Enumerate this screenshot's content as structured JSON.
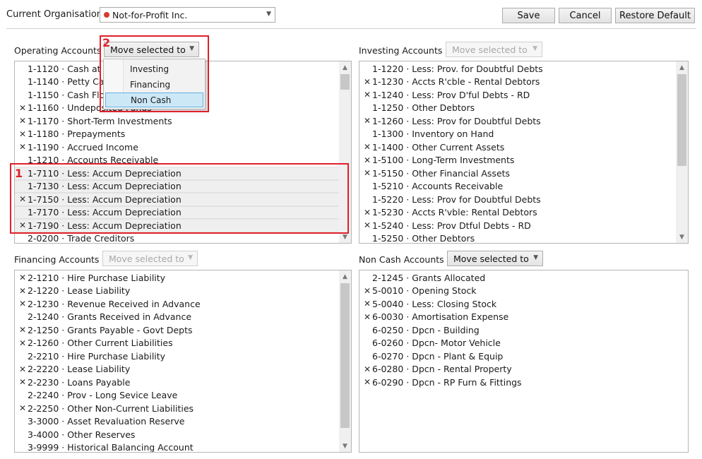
{
  "header": {
    "org_label": "Current Organisation",
    "org_value": "Not-for-Profit Inc.",
    "save": "Save",
    "cancel": "Cancel",
    "restore": "Restore Default",
    "status_color": "#d83a2c"
  },
  "annotations": {
    "one": "1",
    "two": "2",
    "color": "#e0202a"
  },
  "move_label": "Move selected to",
  "menu": {
    "items": [
      "Investing",
      "Financing",
      "Non Cash"
    ],
    "highlighted": "Non Cash"
  },
  "operating": {
    "title": "Operating Accounts",
    "move_enabled": true,
    "rows": [
      {
        "mark": "",
        "text": "1-1120 · Cash at",
        "sel": false
      },
      {
        "mark": "",
        "text": "1-1140 · Petty Ca",
        "sel": false
      },
      {
        "mark": "",
        "text": "1-1150 · Cash Flo",
        "sel": false
      },
      {
        "mark": "✕",
        "text": "1-1160 · Undeposited Funds",
        "sel": false
      },
      {
        "mark": "✕",
        "text": "1-1170 · Short-Term Investments",
        "sel": false
      },
      {
        "mark": "✕",
        "text": "1-1180 · Prepayments",
        "sel": false
      },
      {
        "mark": "✕",
        "text": "1-1190 · Accrued Income",
        "sel": false
      },
      {
        "mark": "",
        "text": "1-1210 · Accounts Receivable",
        "sel": false
      },
      {
        "mark": "",
        "text": "1-7110 · Less: Accum Depreciation",
        "sel": true
      },
      {
        "mark": "",
        "text": "1-7130 · Less: Accum Depreciation",
        "sel": true
      },
      {
        "mark": "✕",
        "text": "1-7150 · Less: Accum Depreciation",
        "sel": true
      },
      {
        "mark": "",
        "text": "1-7170 · Less: Accum Depreciation",
        "sel": true
      },
      {
        "mark": "✕",
        "text": "1-7190 · Less: Accum Depreciation",
        "sel": true
      },
      {
        "mark": "",
        "text": "2-0200 · Trade Creditors",
        "sel": false
      }
    ]
  },
  "investing": {
    "title": "Investing Accounts",
    "move_enabled": false,
    "rows": [
      {
        "mark": "",
        "text": "1-1220 · Less: Prov. for Doubtful Debts",
        "sel": false
      },
      {
        "mark": "✕",
        "text": "1-1230 · Accts R'cble - Rental Debtors",
        "sel": false
      },
      {
        "mark": "✕",
        "text": "1-1240 · Less: Prov D'ful Debts - RD",
        "sel": false
      },
      {
        "mark": "",
        "text": "1-1250 · Other Debtors",
        "sel": false
      },
      {
        "mark": "✕",
        "text": "1-1260 · Less: Prov for Doubtful Debts",
        "sel": false
      },
      {
        "mark": "",
        "text": "1-1300 · Inventory on Hand",
        "sel": false
      },
      {
        "mark": "✕",
        "text": "1-1400 · Other Current Assets",
        "sel": false
      },
      {
        "mark": "✕",
        "text": "1-5100 · Long-Term Investments",
        "sel": false
      },
      {
        "mark": "✕",
        "text": "1-5150 · Other Financial Assets",
        "sel": false
      },
      {
        "mark": "",
        "text": "1-5210 · Accounts Receivable",
        "sel": false
      },
      {
        "mark": "",
        "text": "1-5220 · Less: Prov for Doubtful Debts",
        "sel": false
      },
      {
        "mark": "✕",
        "text": "1-5230 · Accts R'vble: Rental Debtors",
        "sel": false
      },
      {
        "mark": "✕",
        "text": "1-5240 · Less: Prov Dtful Debts - RD",
        "sel": false
      },
      {
        "mark": "",
        "text": "1-5250 · Other Debtors",
        "sel": false
      }
    ]
  },
  "financing": {
    "title": "Financing Accounts",
    "move_enabled": false,
    "rows": [
      {
        "mark": "✕",
        "text": "2-1210 · Hire Purchase Liability",
        "sel": false
      },
      {
        "mark": "✕",
        "text": "2-1220 · Lease Liability",
        "sel": false
      },
      {
        "mark": "✕",
        "text": "2-1230 · Revenue Received in Advance",
        "sel": false
      },
      {
        "mark": "",
        "text": "2-1240 · Grants Received in Advance",
        "sel": false
      },
      {
        "mark": "✕",
        "text": "2-1250 · Grants Payable - Govt Depts",
        "sel": false
      },
      {
        "mark": "✕",
        "text": "2-1260 · Other Current Liabilities",
        "sel": false
      },
      {
        "mark": "",
        "text": "2-2210 · Hire Purchase Liability",
        "sel": false
      },
      {
        "mark": "✕",
        "text": "2-2220 · Lease Liability",
        "sel": false
      },
      {
        "mark": "✕",
        "text": "2-2230 · Loans Payable",
        "sel": false
      },
      {
        "mark": "",
        "text": "2-2240 · Prov - Long Sevice Leave",
        "sel": false
      },
      {
        "mark": "✕",
        "text": "2-2250 · Other Non-Current Liabilities",
        "sel": false
      },
      {
        "mark": "",
        "text": "3-3000 · Asset Revaluation Reserve",
        "sel": false
      },
      {
        "mark": "",
        "text": "3-4000 · Other Reserves",
        "sel": false
      },
      {
        "mark": "",
        "text": "3-9999 · Historical Balancing Account",
        "sel": false
      }
    ]
  },
  "noncash": {
    "title": "Non Cash Accounts",
    "move_enabled": true,
    "rows": [
      {
        "mark": "",
        "text": "2-1245 · Grants Allocated",
        "sel": false
      },
      {
        "mark": "✕",
        "text": "5-0010 · Opening Stock",
        "sel": false
      },
      {
        "mark": "✕",
        "text": "5-0040 · Less: Closing Stock",
        "sel": false
      },
      {
        "mark": "✕",
        "text": "6-0030 · Amortisation Expense",
        "sel": false
      },
      {
        "mark": "",
        "text": "6-0250 · Dpcn - Building",
        "sel": false
      },
      {
        "mark": "",
        "text": "6-0260 · Dpcn- Motor Vehicle",
        "sel": false
      },
      {
        "mark": "",
        "text": "6-0270 · Dpcn - Plant & Equip",
        "sel": false
      },
      {
        "mark": "✕",
        "text": "6-0280 · Dpcn - Rental Property",
        "sel": false
      },
      {
        "mark": "✕",
        "text": "6-0290 · Dpcn - RP Furn & Fittings",
        "sel": false
      }
    ]
  }
}
